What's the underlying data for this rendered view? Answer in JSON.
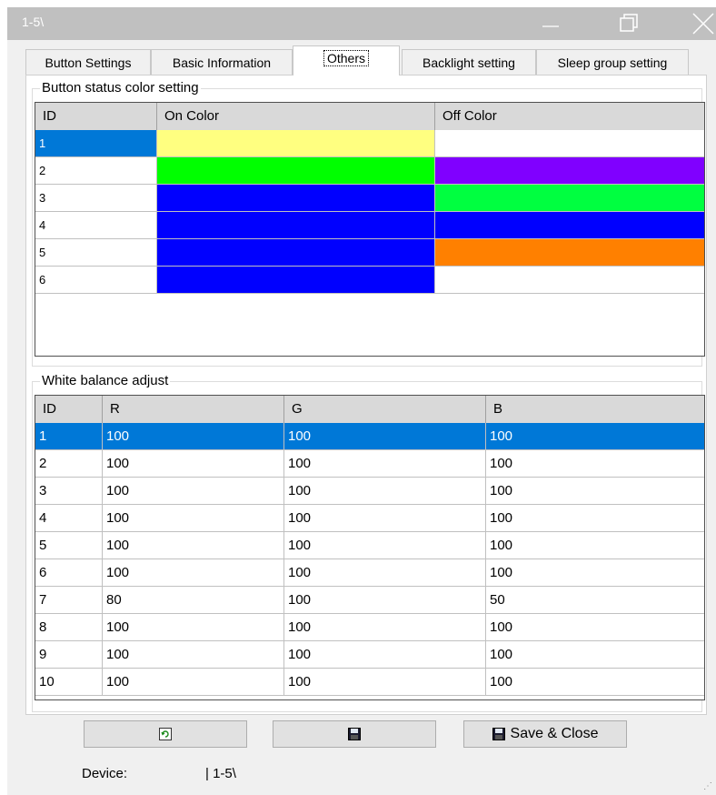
{
  "window": {
    "title": "1-5\\"
  },
  "tabs": [
    {
      "label": "Button Settings"
    },
    {
      "label": "Basic Information"
    },
    {
      "label": "Others"
    },
    {
      "label": "Backlight setting"
    },
    {
      "label": "Sleep group setting"
    }
  ],
  "button_status": {
    "title": "Button status color setting",
    "headers": {
      "id": "ID",
      "on": "On Color",
      "off": "Off Color"
    },
    "rows": [
      {
        "id": "1",
        "on": "#ffff80",
        "off": "#ffffff",
        "selected": true
      },
      {
        "id": "2",
        "on": "#00ff00",
        "off": "#8000ff",
        "selected": false
      },
      {
        "id": "3",
        "on": "#0000ff",
        "off": "#00ff40",
        "selected": false
      },
      {
        "id": "4",
        "on": "#0000ff",
        "off": "#0000ff",
        "selected": false
      },
      {
        "id": "5",
        "on": "#0000ff",
        "off": "#ff8000",
        "selected": false
      },
      {
        "id": "6",
        "on": "#0000ff",
        "off": "#ffffff",
        "selected": false
      }
    ]
  },
  "white_balance": {
    "title": "White balance adjust",
    "headers": {
      "id": "ID",
      "r": "R",
      "g": "G",
      "b": "B"
    },
    "rows": [
      {
        "id": "1",
        "r": "100",
        "g": "100",
        "b": "100",
        "selected": true
      },
      {
        "id": "2",
        "r": "100",
        "g": "100",
        "b": "100",
        "selected": false
      },
      {
        "id": "3",
        "r": "100",
        "g": "100",
        "b": "100",
        "selected": false
      },
      {
        "id": "4",
        "r": "100",
        "g": "100",
        "b": "100",
        "selected": false
      },
      {
        "id": "5",
        "r": "100",
        "g": "100",
        "b": "100",
        "selected": false
      },
      {
        "id": "6",
        "r": "100",
        "g": "100",
        "b": "100",
        "selected": false
      },
      {
        "id": "7",
        "r": "80",
        "g": "100",
        "b": "50",
        "selected": false
      },
      {
        "id": "8",
        "r": "100",
        "g": "100",
        "b": "100",
        "selected": false
      },
      {
        "id": "9",
        "r": "100",
        "g": "100",
        "b": "100",
        "selected": false
      },
      {
        "id": "10",
        "r": "100",
        "g": "100",
        "b": "100",
        "selected": false
      }
    ]
  },
  "buttons": {
    "refresh_icon": "refresh-icon",
    "save_icon": "floppy-disk-icon",
    "save_close_label": "Save & Close"
  },
  "status": {
    "device_label": "Device:",
    "device_value": "| 1-5\\"
  },
  "colors": {
    "selection": "#0078d7",
    "titlebar": "#c0c0c0"
  }
}
